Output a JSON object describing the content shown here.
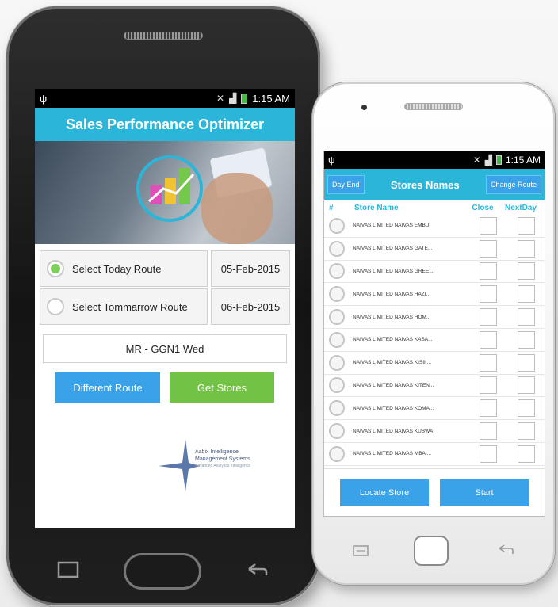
{
  "phone1": {
    "status": {
      "time": "1:15 AM"
    },
    "title": "Sales Performance Optimizer",
    "routes": [
      {
        "label": "Select Today Route",
        "date": "05-Feb-2015",
        "selected": true
      },
      {
        "label": "Select Tommarrow Route",
        "date": "06-Feb-2015",
        "selected": false
      }
    ],
    "route_name": "MR - GGN1 Wed",
    "buttons": {
      "different_route": "Different Route",
      "get_stores": "Get Stores"
    },
    "logo_text": {
      "line1": "Aabix Intelligence",
      "line2": "Management Systems",
      "line3": "Advanced Analytics Intelligence"
    }
  },
  "phone2": {
    "status": {
      "time": "1:15 AM"
    },
    "header": {
      "day_end": "Day End",
      "title": "Stores Names",
      "change_route": "Change Route"
    },
    "columns": {
      "hash": "#",
      "store_name": "Store Name",
      "close": "Close",
      "next_day": "NextDay"
    },
    "stores": [
      "NAIVAS LIMITED NAIVAS EMBU",
      "NAIVAS LIMITED NAIVAS GATE...",
      "NAIVAS LIMITED NAIVAS GREE...",
      "NAIVAS LIMITED NAIVAS HAZI...",
      "NAIVAS LIMITED NAIVAS HOM...",
      "NAIVAS LIMITED NAIVAS KASA...",
      "NAIVAS LIMITED NAIVAS KISII ...",
      "NAIVAS LIMITED NAIVAS KITEN...",
      "NAIVAS LIMITED NAIVAS KOMA...",
      "NAIVAS LIMITED NAIVAS KUBWA",
      "NAIVAS LIMITED NAIVAS MBAI..."
    ],
    "buttons": {
      "locate_store": "Locate Store",
      "start": "Start"
    }
  },
  "colors": {
    "header": "#2bb6d9",
    "button_blue": "#3aa2e8",
    "button_green": "#72c345",
    "radio_selected": "#7ed05a"
  }
}
